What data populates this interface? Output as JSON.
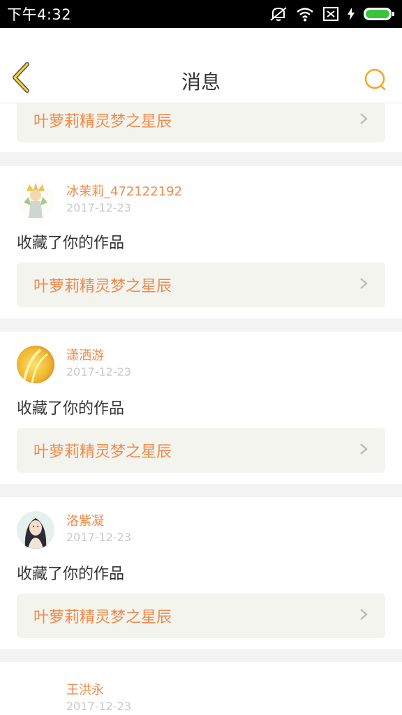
{
  "status_bar": {
    "time": "下午4:32",
    "icons": [
      "mute-icon",
      "wifi-icon",
      "no-sim-icon",
      "charging-icon",
      "battery-icon"
    ]
  },
  "header": {
    "title": "消息",
    "back_icon": "chevron-left-icon",
    "search_icon": "search-icon",
    "accent_color": "#f5a623"
  },
  "colors": {
    "accent_text": "#f08a4b",
    "work_link_bg": "#f4f4ee",
    "date_text": "#c9c9c9",
    "separator_bg": "#f3f3f3"
  },
  "messages": [
    {
      "work_title": "叶萝莉精灵梦之星辰"
    },
    {
      "user_name": "冰茉莉_472122192",
      "date": "2017-12-23",
      "action": "收藏了你的作品",
      "work_title": "叶萝莉精灵梦之星辰"
    },
    {
      "user_name": "潇洒游",
      "date": "2017-12-23",
      "action": "收藏了你的作品",
      "work_title": "叶萝莉精灵梦之星辰"
    },
    {
      "user_name": "洛紫凝",
      "date": "2017-12-23",
      "action": "收藏了你的作品",
      "work_title": "叶萝莉精灵梦之星辰"
    },
    {
      "user_name": "王洪永",
      "date": "2017-12-23"
    }
  ]
}
